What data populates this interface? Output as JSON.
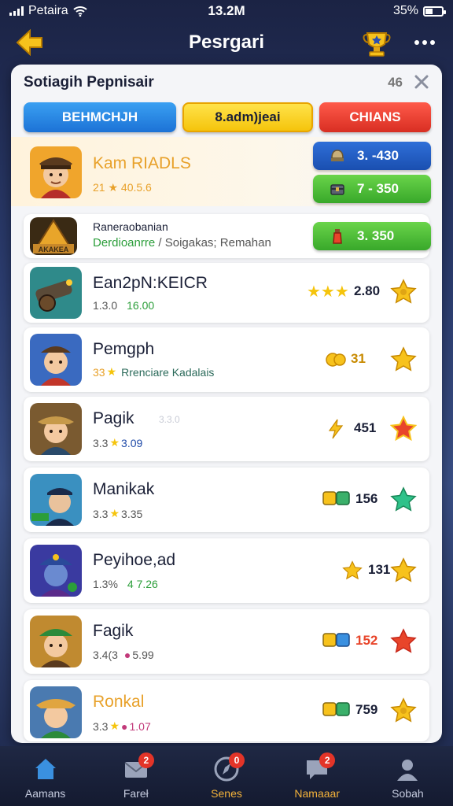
{
  "status": {
    "carrier": "Petaira",
    "time": "13.2M",
    "battery": "35%"
  },
  "header": {
    "title": "Pesrgari"
  },
  "panel": {
    "title": "Sotiagih Pepnisair",
    "count": "46"
  },
  "tabs": [
    "BEHMCHJH",
    "8.adm)jeai",
    "CHIANS"
  ],
  "featured": {
    "name": "Kam RIADLS",
    "sub_a": "21",
    "sub_b": "40.5.6",
    "pill_1": "3. -430",
    "pill_2": "7 - 350"
  },
  "pinned": {
    "thumb_label": "AKAKEA",
    "title": "Raneraobanian",
    "sub_green": "Derdioanrre",
    "sub_gray": "/ Soigakas; Remahan",
    "pill": "3.  350"
  },
  "rows": [
    {
      "name": "Ean2pN:KEICR",
      "a": "1.3.0",
      "b": "16.00",
      "b_color": "green",
      "score": "2.80"
    },
    {
      "name": "Pemgph",
      "a": "33",
      "b": "Rrenciare Kadalais",
      "b_color": "gray",
      "score": "31"
    },
    {
      "name": "Pagik",
      "a": "3.3",
      "b": "3.09",
      "b_color": "blue",
      "score": "451",
      "mark": "3.3.0"
    },
    {
      "name": "Manikak",
      "a": "3.3",
      "b": "3.35",
      "b_color": "gray",
      "score": "156"
    },
    {
      "name": "Peyihoe,ad",
      "a": "1.3%",
      "b": "4 7.26",
      "b_color": "green",
      "score": "131"
    },
    {
      "name": "Fagik",
      "a": "3.4(3",
      "b": "5.99",
      "b_color": "gray",
      "score": "152"
    },
    {
      "name": "Ronkal",
      "a": "3.3",
      "b": "1.07",
      "b_color": "pink",
      "score": "759"
    }
  ],
  "nav": [
    {
      "label": "Aamans",
      "icon": "home-icon",
      "badge": ""
    },
    {
      "label": "Fareł",
      "icon": "mail-icon",
      "badge": "2"
    },
    {
      "label": "Senes",
      "icon": "compass-icon",
      "badge": "0"
    },
    {
      "label": "Namaaar",
      "icon": "chat-icon",
      "badge": "2"
    },
    {
      "label": "Sobah",
      "icon": "profile-icon",
      "badge": ""
    }
  ],
  "colors": {
    "accent_yellow": "#f5c40c",
    "accent_blue": "#1c72d6",
    "accent_red": "#d82e22",
    "accent_green": "#38a82a"
  }
}
